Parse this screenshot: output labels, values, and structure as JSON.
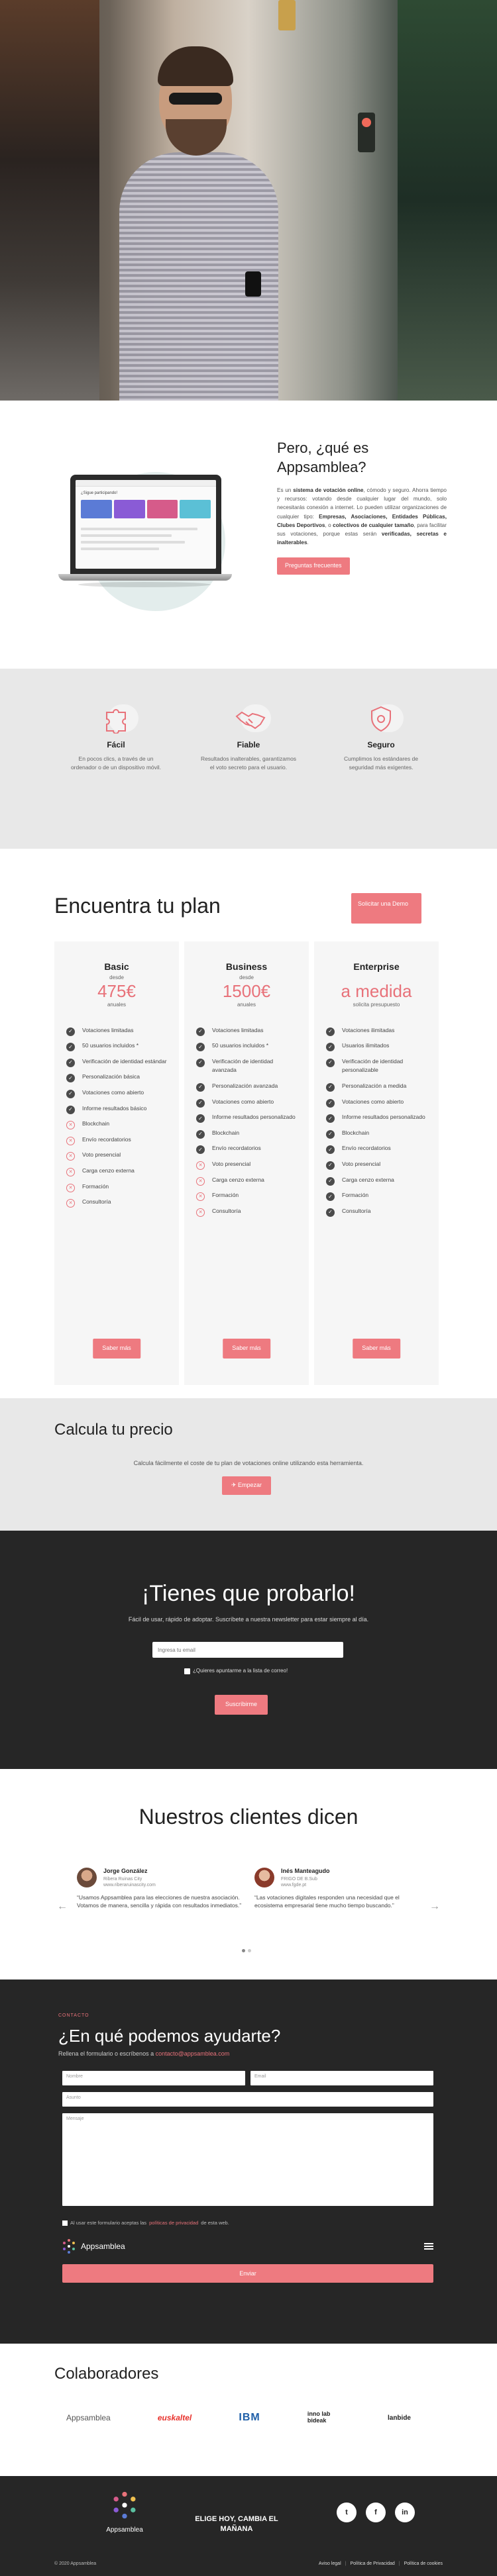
{
  "intro": {
    "title": "Pero, ¿qué es Appsamblea?",
    "p1": "Es un ",
    "b1": "sistema de votación online",
    "p2": ", cómodo y seguro. Ahorra tiempo y recursos: votando desde cualquier lugar del mundo, solo necesitarás conexión a internet. Lo pueden utilizar organizaciones de cualquier tipo: ",
    "b2": "Empresas, Asociaciones, Entidades Públicas, Clubes Deportivos",
    "p3": ", o ",
    "b3": "colectivos de cualquier tamaño",
    "p4": ", para facilitar sus votaciones, porque estas serán ",
    "b4": "verificadas, secretas e inalterables",
    "p5": ".",
    "faq_button": "Preguntas frecuentes",
    "screen_title": "¿Sigue participando!"
  },
  "features": [
    {
      "title": "Fácil",
      "text": "En pocos clics, a través de un ordenador o de un dispositivo móvil.",
      "icon": "puzzle-icon"
    },
    {
      "title": "Fiable",
      "text": "Resultados inalterables, garantizamos el voto secreto para el usuario.",
      "icon": "handshake-icon"
    },
    {
      "title": "Seguro",
      "text": "Cumplimos los estándares de seguridad más exigentes.",
      "icon": "shield-icon"
    }
  ],
  "plans": {
    "title": "Encuentra tu plan",
    "demo_button": "Solicitar una Demo",
    "cards": [
      {
        "name": "Basic",
        "from": "desde",
        "price": "475€",
        "per": "anuales",
        "button": "Saber más",
        "features": [
          {
            "label": "Votaciones limitadas",
            "ok": true
          },
          {
            "label": "50 usuarios incluidos *",
            "ok": true
          },
          {
            "label": "Verificación de identidad estándar",
            "ok": true
          },
          {
            "label": "Personalización básica",
            "ok": true
          },
          {
            "label": "Votaciones como abierto",
            "ok": true
          },
          {
            "label": "Informe resultados básico",
            "ok": true
          },
          {
            "label": "Blockchain",
            "ok": false
          },
          {
            "label": "Envío recordatorios",
            "ok": false
          },
          {
            "label": "Voto presencial",
            "ok": false
          },
          {
            "label": "Carga cenzo externa",
            "ok": false
          },
          {
            "label": "Formación",
            "ok": false
          },
          {
            "label": "Consultoría",
            "ok": false
          }
        ]
      },
      {
        "name": "Business",
        "from": "desde",
        "price": "1500€",
        "per": "anuales",
        "button": "Saber más",
        "features": [
          {
            "label": "Votaciones limitadas",
            "ok": true
          },
          {
            "label": "50 usuarios incluidos *",
            "ok": true
          },
          {
            "label": "Verificación de identidad avanzada",
            "ok": true
          },
          {
            "label": "Personalización avanzada",
            "ok": true
          },
          {
            "label": "Votaciones como abierto",
            "ok": true
          },
          {
            "label": "Informe resultados personalizado",
            "ok": true
          },
          {
            "label": "Blockchain",
            "ok": true
          },
          {
            "label": "Envío recordatorios",
            "ok": true
          },
          {
            "label": "Voto presencial",
            "ok": false
          },
          {
            "label": "Carga cenzo externa",
            "ok": false
          },
          {
            "label": "Formación",
            "ok": false
          },
          {
            "label": "Consultoría",
            "ok": false
          }
        ]
      },
      {
        "name": "Enterprise",
        "from": "",
        "price": "a medida",
        "per": "solicita presupuesto",
        "button": "Saber más",
        "features": [
          {
            "label": "Votaciones ilimitadas",
            "ok": true
          },
          {
            "label": "Usuarios ilimitados",
            "ok": true
          },
          {
            "label": "Verificación de identidad personalizable",
            "ok": true
          },
          {
            "label": "Personalización a medida",
            "ok": true
          },
          {
            "label": "Votaciones como abierto",
            "ok": true
          },
          {
            "label": "Informe resultados personalizado",
            "ok": true
          },
          {
            "label": "Blockchain",
            "ok": true
          },
          {
            "label": "Envío recordatorios",
            "ok": true
          },
          {
            "label": "Voto presencial",
            "ok": true
          },
          {
            "label": "Carga cenzo externa",
            "ok": true
          },
          {
            "label": "Formación",
            "ok": true
          },
          {
            "label": "Consultoría",
            "ok": true
          }
        ]
      }
    ]
  },
  "calc": {
    "title": "Calcula tu precio",
    "text": "Calcula fácilmente el coste de tu plan de votaciones online utilizando esta herramienta.",
    "button": "✈ Empezar"
  },
  "try": {
    "title": "¡Tienes que probarlo!",
    "text": "Fácil de usar, rápido de adoptar. Suscríbete a nuestra newsletter para estar siempre al día.",
    "email_placeholder": "Ingresa tu email",
    "checkbox": "¿Quieres apuntarme a la lista de correo!",
    "button": "Suscríbirme"
  },
  "clients": {
    "title": "Nuestros clientes dicen",
    "prev": "←",
    "next": "→",
    "items": [
      {
        "name": "Jorge González",
        "org": "Ribera Ruinas City",
        "site": "www.riberaruinascity.com",
        "quote": "“Usamos Appsamblea para las elecciones de nuestra asociación. Votamos de manera, sencilla y rápida con resultados inmediatos.”"
      },
      {
        "name": "Inés Manteagudo",
        "org": "FRIGO DE B.Sub",
        "site": "www.fgde.pt",
        "quote": "“Las votaciones digitales responden una necesidad que el ecosistema empresarial tiene mucho tiempo buscando.”"
      }
    ]
  },
  "contact": {
    "kicker": "CONTACTO",
    "title": "¿En qué podemos ayudarte?",
    "sub_prefix": "Rellena el formulario o escríbenos a ",
    "email": "contacto@appsamblea.com",
    "name_ph": "Nombre",
    "email_ph": "Email",
    "subject_ph": "Asunto",
    "message_ph": "Mensaje",
    "legal_prefix": "Al usar este formulario aceptas las ",
    "legal_link": "políticas de privacidad",
    "legal_suffix": " de esta web.",
    "brand": "Appsamblea",
    "submit": "Enviar"
  },
  "partners": {
    "title": "Colaboradores",
    "logos": [
      "Appsamblea",
      "euskaltel",
      "IBM",
      "inno lab bideak",
      "lanbide"
    ]
  },
  "footer": {
    "brand": "Appsamblea",
    "slogan": "ELIGE HOY, CAMBIA EL MAÑANA",
    "social": [
      "t",
      "f",
      "in"
    ],
    "copy": "© 2020 Appsamblea",
    "links": [
      "Aviso legal",
      "Política de Privacidad",
      "Política de cookies"
    ],
    "sep": "|"
  },
  "colors": {
    "accent": "#ee7a80",
    "dark": "#262626",
    "light_gray": "#e8e8e8"
  }
}
